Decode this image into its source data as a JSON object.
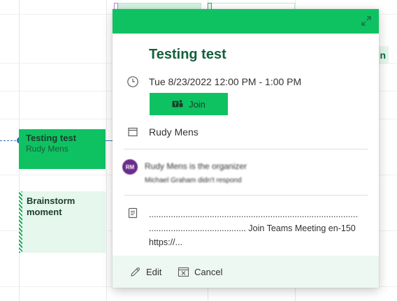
{
  "popup": {
    "title": "Testing test",
    "datetime": "Tue 8/23/2022 12:00 PM - 1:00 PM",
    "join_label": "Join",
    "calendar_owner": "Rudy Mens",
    "attendee": {
      "initials": "RM",
      "name": "Rudy Mens is the organizer",
      "status": "Michael Graham didn't respond"
    },
    "description_lines": [
      "............................................................................................",
      "........................................ Join Teams Meeting en-150",
      "https://..."
    ],
    "footer": {
      "edit_label": "Edit",
      "cancel_label": "Cancel"
    }
  },
  "calendar": {
    "events": [
      {
        "title": "Testing test",
        "organizer": "Rudy Mens"
      },
      {
        "title": "Brainstorm moment"
      }
    ],
    "right_peek_text": "n"
  },
  "colors": {
    "accent": "#0ec262",
    "title_green": "#14613a",
    "footer_bg": "#ecf8f1",
    "now_line": "#2f6fb5"
  }
}
